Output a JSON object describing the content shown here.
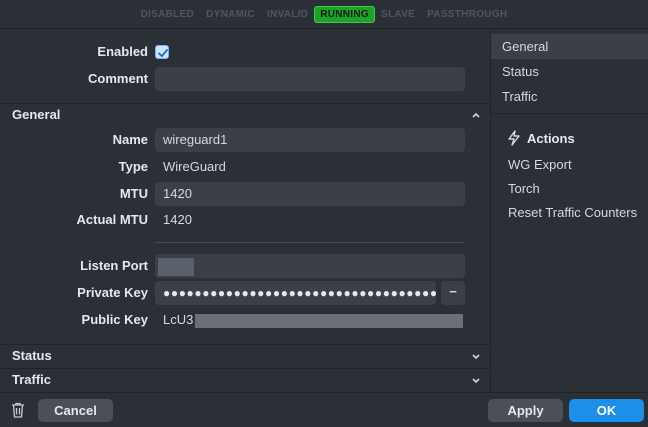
{
  "status_flags": [
    {
      "label": "DISABLED",
      "active": false
    },
    {
      "label": "DYNAMIC",
      "active": false
    },
    {
      "label": "INVALID",
      "active": false
    },
    {
      "label": "RUNNING",
      "active": true
    },
    {
      "label": "SLAVE",
      "active": false
    },
    {
      "label": "PASSTHROUGH",
      "active": false
    }
  ],
  "form": {
    "enabled_label": "Enabled",
    "enabled_checked": true,
    "comment_label": "Comment",
    "comment_value": "",
    "general_section": "General",
    "name_label": "Name",
    "name_value": "wireguard1",
    "type_label": "Type",
    "type_value": "WireGuard",
    "mtu_label": "MTU",
    "mtu_value": "1420",
    "actual_mtu_label": "Actual MTU",
    "actual_mtu_value": "1420",
    "listen_port_label": "Listen Port",
    "private_key_label": "Private Key",
    "private_key_value": "●●●●●●●●●●●●●●●●●●●●●●●●●●●●●●●●●●●●●",
    "private_key_toggle": "−",
    "public_key_label": "Public Key",
    "public_key_prefix": "LcU3",
    "status_section": "Status",
    "traffic_section": "Traffic"
  },
  "sidebar": {
    "nav": [
      {
        "label": "General",
        "selected": true
      },
      {
        "label": "Status",
        "selected": false
      },
      {
        "label": "Traffic",
        "selected": false
      }
    ],
    "actions_title": "Actions",
    "actions": [
      "WG Export",
      "Torch",
      "Reset Traffic Counters"
    ]
  },
  "footer": {
    "cancel_label": "Cancel",
    "apply_label": "Apply",
    "ok_label": "OK"
  },
  "colors": {
    "background": "#2b2f36",
    "running": "#1fa12a",
    "ok_button": "#1e8fe8"
  }
}
